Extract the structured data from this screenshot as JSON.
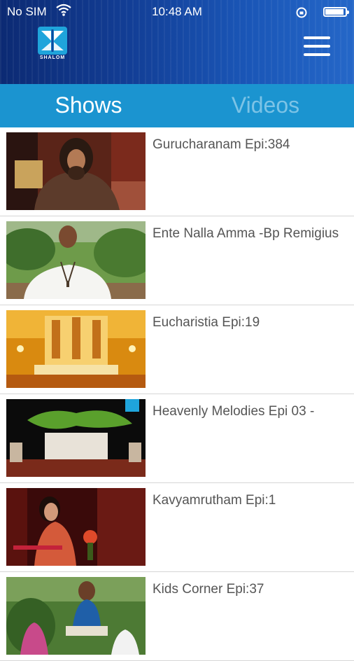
{
  "status_bar": {
    "carrier": "No SIM",
    "time": "10:48 AM"
  },
  "header": {
    "logo_text": "SHALOM",
    "menu_icon": "hamburger-menu-icon"
  },
  "tabs": [
    {
      "label": "Shows",
      "active": true
    },
    {
      "label": "Videos",
      "active": false
    }
  ],
  "shows": [
    {
      "title": "Gurucharanam Epi:384"
    },
    {
      "title": "Ente Nalla Amma -Bp Remigius"
    },
    {
      "title": "Eucharistia Epi:19"
    },
    {
      "title": "Heavenly Melodies Epi 03 -"
    },
    {
      "title": "Kavyamrutham Epi:1"
    },
    {
      "title": "Kids Corner Epi:37"
    }
  ],
  "colors": {
    "header_dark": "#0c2a73",
    "header_light": "#2567c8",
    "tab_bar": "#1b94d0",
    "tab_inactive": "#7cc3e6"
  }
}
